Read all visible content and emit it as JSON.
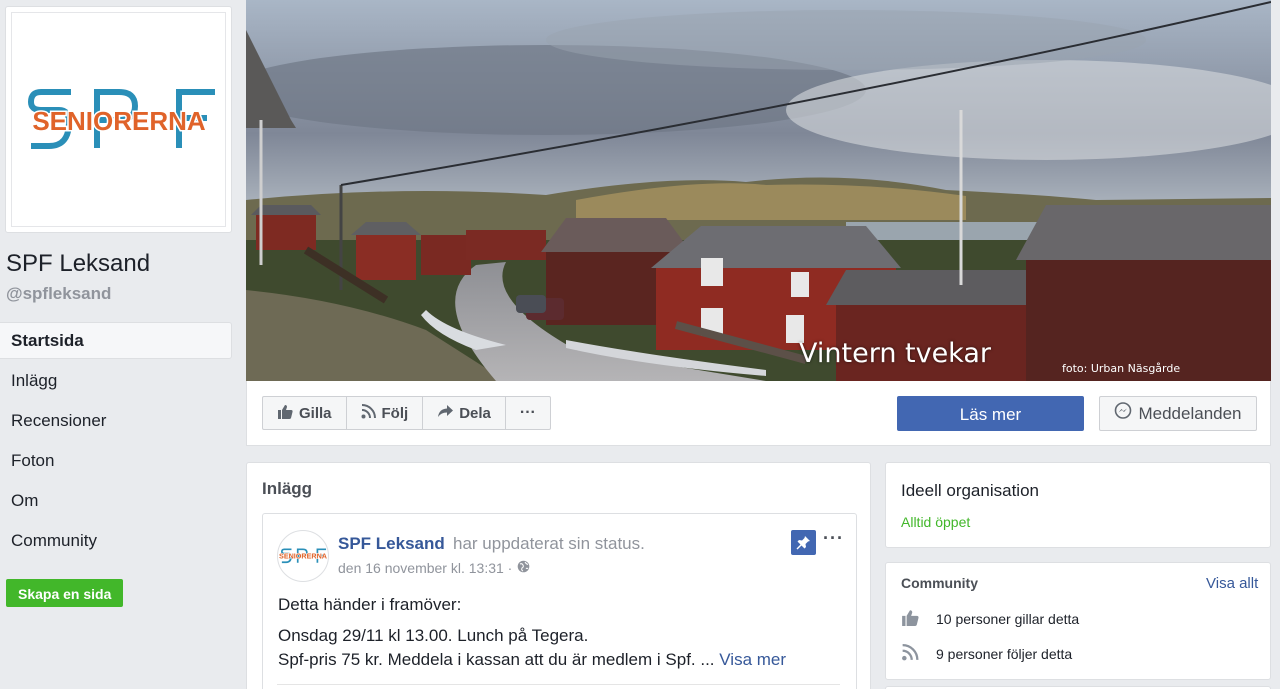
{
  "page": {
    "name": "SPF Leksand",
    "handle": "@spfleksand",
    "logo_text": "SENIORERNA",
    "logo_letters": "SPF"
  },
  "nav": {
    "items": [
      {
        "label": "Startsida"
      },
      {
        "label": "Inlägg"
      },
      {
        "label": "Recensioner"
      },
      {
        "label": "Foton"
      },
      {
        "label": "Om"
      },
      {
        "label": "Community"
      }
    ],
    "create_page": "Skapa en sida"
  },
  "cover": {
    "caption": "Vintern tvekar",
    "credit": "foto: Urban Näsgårde"
  },
  "actions": {
    "like": "Gilla",
    "follow": "Följ",
    "share": "Dela",
    "more": "···",
    "read_more": "Läs mer",
    "messages": "Meddelanden"
  },
  "posts": {
    "title": "Inlägg",
    "post": {
      "author": "SPF Leksand",
      "action": "har uppdaterat sin status.",
      "date": "den 16 november kl. 13:31 ·",
      "line1": "Detta händer i framöver:",
      "line2": "Onsdag 29/11 kl 13.00. Lunch på Tegera.",
      "line3": "Spf-pris 75 kr. Meddela i kassan att du är medlem i Spf. ...",
      "see_more": "Visa mer",
      "more": "···"
    }
  },
  "about": {
    "category": "Ideell organisation",
    "hours": "Alltid öppet"
  },
  "community": {
    "title": "Community",
    "view_all": "Visa allt",
    "likes": "10 personer gillar detta",
    "follows": "9 personer följer detta"
  },
  "colors": {
    "brand_blue": "#4267b2",
    "link": "#365899",
    "green": "#42b72a",
    "logo_teal": "#2a8fb8",
    "logo_orange": "#e0632a"
  }
}
